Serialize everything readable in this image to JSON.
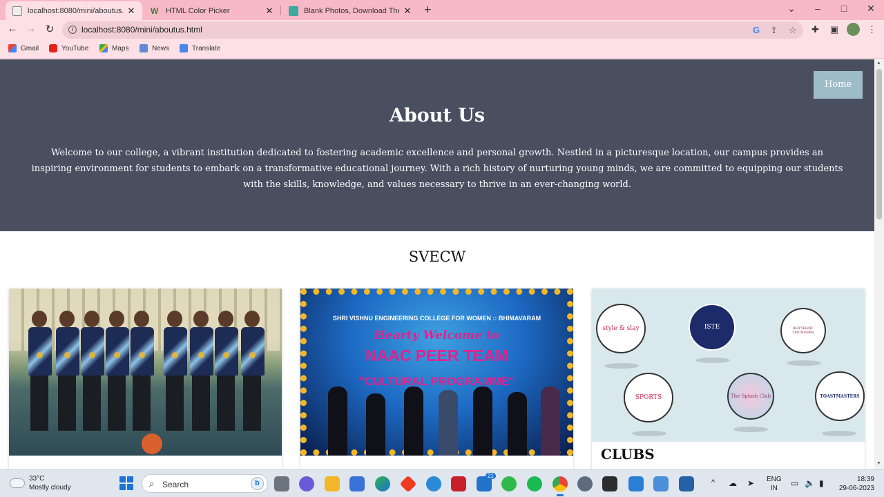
{
  "browser": {
    "tabs": [
      {
        "title": "localhost:8080/mini/aboutus.html",
        "active": true
      },
      {
        "title": "HTML Color Picker",
        "active": false
      },
      {
        "title": "Blank Photos, Download The BES",
        "active": false
      }
    ],
    "url": "localhost:8080/mini/aboutus.html",
    "bookmarks": [
      "Gmail",
      "YouTube",
      "Maps",
      "News",
      "Translate"
    ],
    "colors": {
      "tabstrip": "#f8b9c6",
      "toolbar": "#fde0e6"
    }
  },
  "page": {
    "nav": {
      "home_label": "Home"
    },
    "hero": {
      "title": "About Us",
      "text": "Welcome to our college, a vibrant institution dedicated to fostering academic excellence and personal growth. Nestled in a picturesque location, our campus provides an inspiring environment for students to embark on a transformative educational journey. With a rich history of nurturing young minds, we are committed to equipping our students with the skills, knowledge, and values necessary to thrive in an ever-changing world."
    },
    "section_title": "SVECW",
    "cards": [
      {
        "caption": ""
      },
      {
        "caption": "",
        "banner_line1": "SHRI VISHNU ENGINEERING COLLEGE FOR WOMEN :: BHIMAVARAM",
        "banner_line2": "Hearty Welcome to",
        "banner_line3": "NAAC PEER TEAM",
        "banner_line4": "\"CULTURAL PROGRAMME\""
      },
      {
        "caption": "CLUBS",
        "logo_texts": [
          "style & slay",
          "ISTE",
          "RHYTHMIC THUNDERS",
          "SPORTS",
          "The Splash Club",
          "TOASTMASTERS"
        ]
      }
    ],
    "colors": {
      "hero_bg": "#494f5f",
      "home_btn": "#9dbcc8"
    }
  },
  "taskbar": {
    "weather_temp": "33°C",
    "weather_desc": "Mostly cloudy",
    "search_placeholder": "Search",
    "mail_badge": "21",
    "lang_line1": "ENG",
    "lang_line2": "IN",
    "time": "18:39",
    "date": "29-06-2023"
  }
}
